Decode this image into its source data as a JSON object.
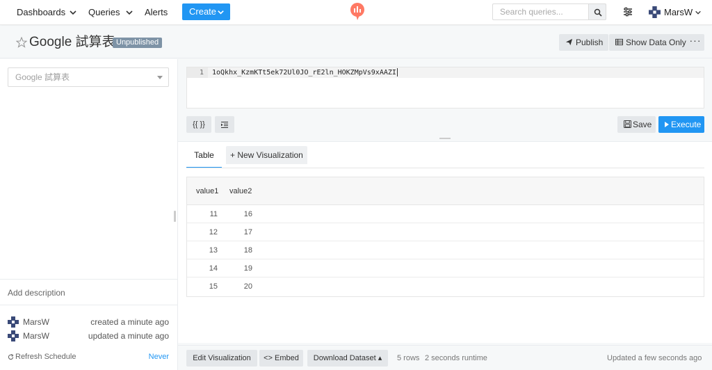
{
  "nav": {
    "dashboards": "Dashboards",
    "queries": "Queries",
    "alerts": "Alerts",
    "create": "Create",
    "search_placeholder": "Search queries...",
    "user": "MarsW"
  },
  "query": {
    "title": "Google 試算表",
    "status_badge": "Unpublished",
    "publish_label": "Publish",
    "show_data_only_label": "Show Data Only",
    "more_label": "···"
  },
  "left_panel": {
    "data_source": "Google 試算表",
    "add_description": "Add description",
    "created": {
      "user": "MarsW",
      "status": "created a minute ago"
    },
    "updated": {
      "user": "MarsW",
      "status": "updated a minute ago"
    },
    "refresh_schedule_label": "Refresh Schedule",
    "refresh_schedule_value": "Never"
  },
  "editor": {
    "line_number": "1",
    "code": "1oQkhx_KzmKTt5ek72Ul0JO_rE2ln_HOKZMpVs9xAAZI"
  },
  "editor_toolbar": {
    "params_label": "{{ }}",
    "format_label": "≡",
    "save_label": "Save",
    "execute_label": "Execute"
  },
  "results": {
    "tab_table": "Table",
    "tab_new_viz": "+ New Visualization",
    "columns": [
      "value1",
      "value2"
    ],
    "rows": [
      [
        "11",
        "16"
      ],
      [
        "12",
        "17"
      ],
      [
        "13",
        "18"
      ],
      [
        "14",
        "19"
      ],
      [
        "15",
        "20"
      ]
    ]
  },
  "bottom": {
    "edit_visualization": "Edit Visualization",
    "embed": "<> Embed",
    "download_dataset": "Download Dataset ▴",
    "rows_count": "5 rows",
    "runtime": "2 seconds runtime",
    "updated": "Updated a few seconds ago"
  },
  "colors": {
    "primary": "#2196f3",
    "logo": "#ff7964",
    "badge": "#7e93a6"
  }
}
